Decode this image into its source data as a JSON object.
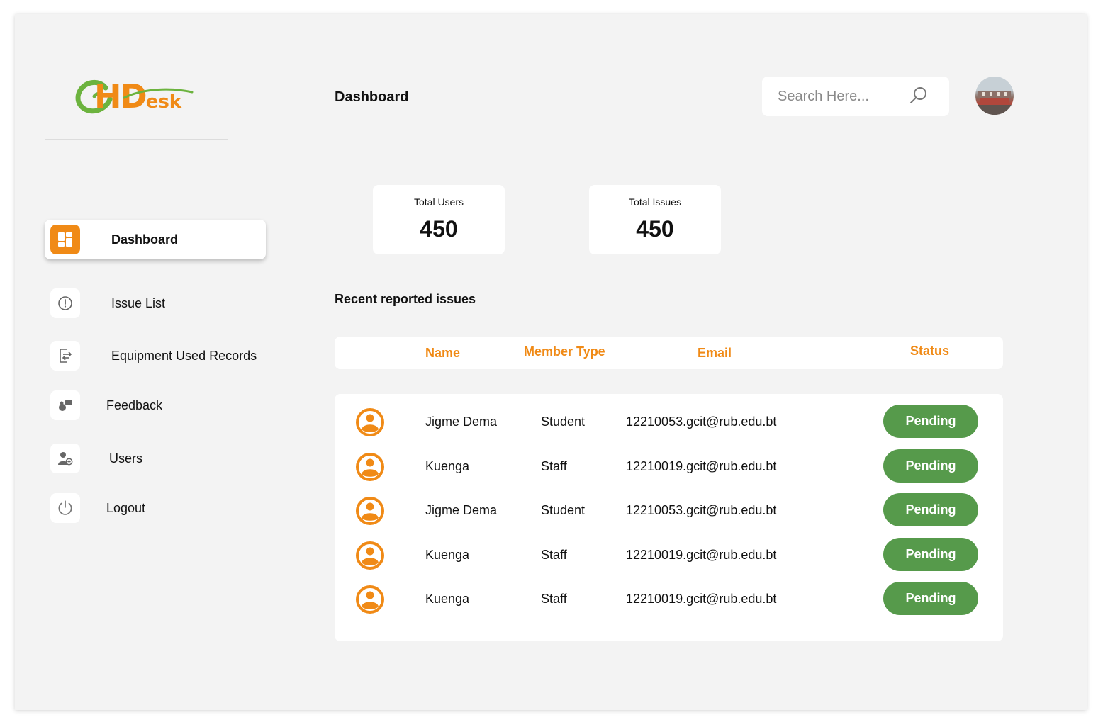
{
  "app": {
    "logo_text_big": "HD",
    "logo_text_small": "esk"
  },
  "header": {
    "title": "Dashboard",
    "search_placeholder": "Search Here..."
  },
  "sidebar": {
    "items": [
      {
        "label": "Dashboard",
        "icon": "dashboard-icon",
        "active": true
      },
      {
        "label": "Issue List",
        "icon": "alert-circle-icon"
      },
      {
        "label": "Equipment Used Records",
        "icon": "file-transfer-icon"
      },
      {
        "label": "Feedback",
        "icon": "feedback-icon"
      },
      {
        "label": "Users",
        "icon": "user-add-icon"
      },
      {
        "label": "Logout",
        "icon": "power-icon"
      }
    ]
  },
  "stats": [
    {
      "label": "Total Users",
      "value": "450"
    },
    {
      "label": "Total Issues",
      "value": "450"
    }
  ],
  "recent": {
    "title": "Recent reported issues",
    "columns": [
      "Name",
      "Member Type",
      "Email",
      "Status"
    ],
    "rows": [
      {
        "name": "Jigme Dema",
        "type": "Student",
        "email": "12210053.gcit@rub.edu.bt",
        "status": "Pending"
      },
      {
        "name": "Kuenga",
        "type": "Staff",
        "email": "12210019.gcit@rub.edu.bt",
        "status": "Pending"
      },
      {
        "name": "Jigme Dema",
        "type": "Student",
        "email": "12210053.gcit@rub.edu.bt",
        "status": "Pending"
      },
      {
        "name": "Kuenga",
        "type": "Staff",
        "email": "12210019.gcit@rub.edu.bt",
        "status": "Pending"
      },
      {
        "name": "Kuenga",
        "type": "Staff",
        "email": "12210019.gcit@rub.edu.bt",
        "status": "Pending"
      }
    ]
  },
  "colors": {
    "accent": "#f08a16",
    "status_pending": "#569a4b",
    "logo_green": "#6cb33e"
  }
}
